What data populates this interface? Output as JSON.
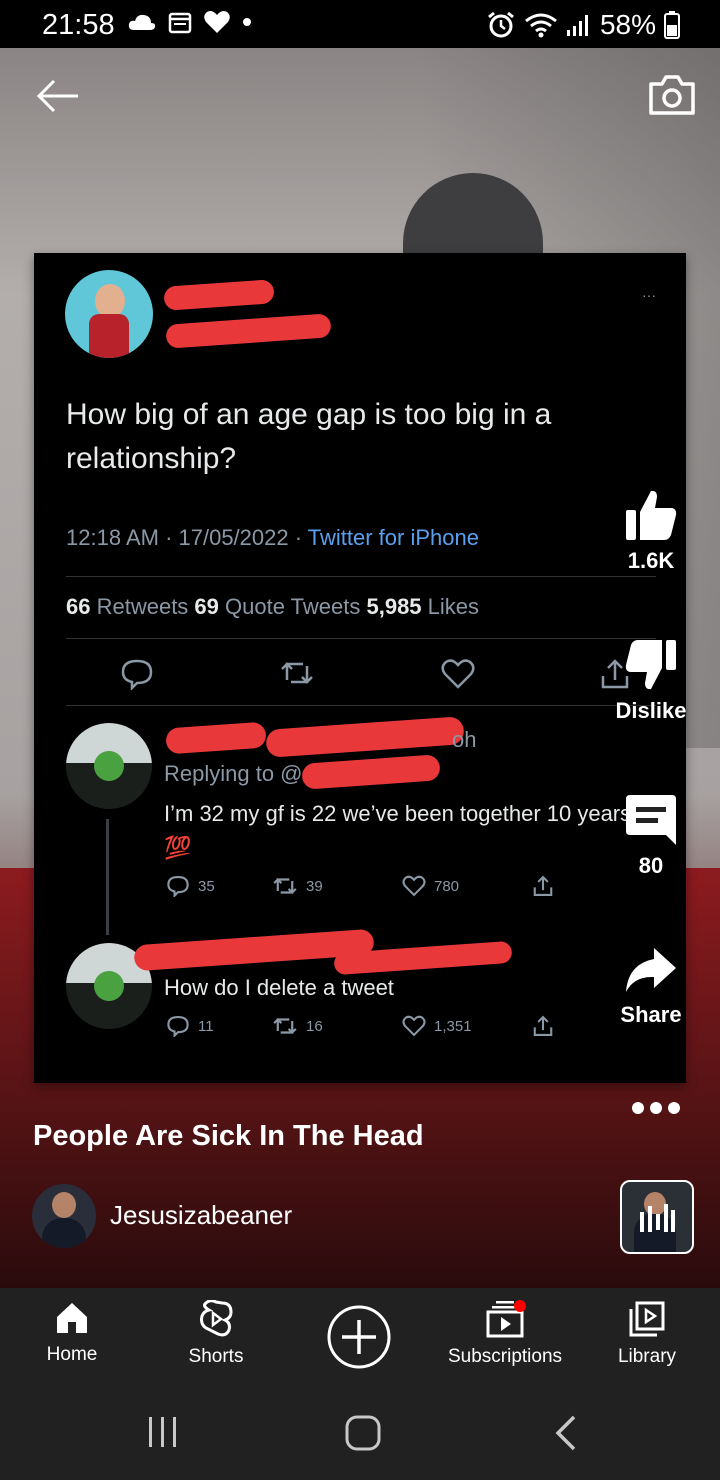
{
  "status_bar": {
    "time": "21:58",
    "battery": "58%"
  },
  "tweet": {
    "question": "How big of an age gap is too big in a relationship?",
    "timestamp": "12:18 AM · 17/05/2022 · ",
    "source": "Twitter for iPhone",
    "retweets_count": "66",
    "retweets_label": " Retweets  ",
    "quotes_count": "69",
    "quotes_label": " Quote Tweets  ",
    "likes_count": "5,985",
    "likes_label": " Likes",
    "more": "···",
    "replies": [
      {
        "handle_fragment": "oh",
        "replying_to": "Replying to @",
        "text": "I’m 32 my gf is 22 we’ve been together 10 years 💯",
        "reply_count": "35",
        "retweet_count": "39",
        "like_count": "780"
      },
      {
        "text": "How do I delete a tweet",
        "reply_count": "11",
        "retweet_count": "16",
        "like_count": "1,351"
      }
    ]
  },
  "side_actions": {
    "like_count": "1.6K",
    "dislike_label": "Dislike",
    "comments_count": "80",
    "share_label": "Share"
  },
  "video": {
    "title": "People Are Sick In The Head",
    "channel": "Jesusizabeaner"
  },
  "bottom_nav": {
    "home": "Home",
    "shorts": "Shorts",
    "subscriptions": "Subscriptions",
    "library": "Library"
  },
  "colors": {
    "accent_red": "#ff0000",
    "twitter_link": "#5aa0ef",
    "redaction": "#e8383a",
    "nav_bg": "#212121"
  }
}
